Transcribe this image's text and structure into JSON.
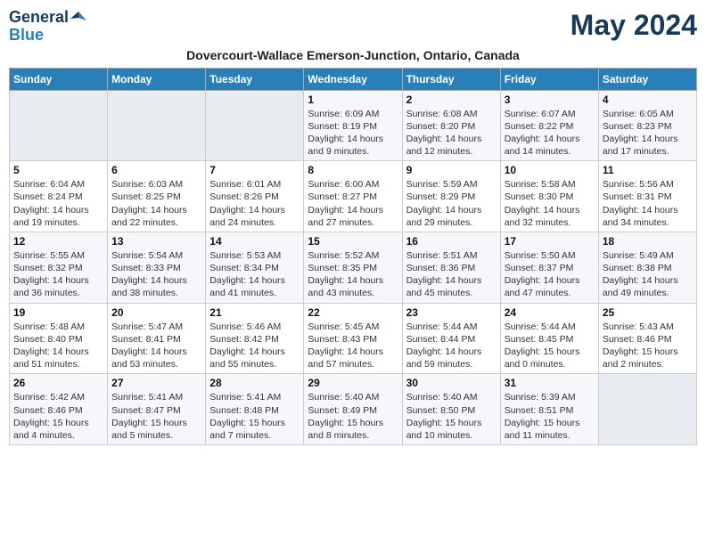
{
  "header": {
    "logo_general": "General",
    "logo_blue": "Blue",
    "month_title": "May 2024",
    "location": "Dovercourt-Wallace Emerson-Junction, Ontario, Canada"
  },
  "days_of_week": [
    "Sunday",
    "Monday",
    "Tuesday",
    "Wednesday",
    "Thursday",
    "Friday",
    "Saturday"
  ],
  "weeks": [
    [
      {
        "day": "",
        "info": ""
      },
      {
        "day": "",
        "info": ""
      },
      {
        "day": "",
        "info": ""
      },
      {
        "day": "1",
        "info": "Sunrise: 6:09 AM\nSunset: 8:19 PM\nDaylight: 14 hours\nand 9 minutes."
      },
      {
        "day": "2",
        "info": "Sunrise: 6:08 AM\nSunset: 8:20 PM\nDaylight: 14 hours\nand 12 minutes."
      },
      {
        "day": "3",
        "info": "Sunrise: 6:07 AM\nSunset: 8:22 PM\nDaylight: 14 hours\nand 14 minutes."
      },
      {
        "day": "4",
        "info": "Sunrise: 6:05 AM\nSunset: 8:23 PM\nDaylight: 14 hours\nand 17 minutes."
      }
    ],
    [
      {
        "day": "5",
        "info": "Sunrise: 6:04 AM\nSunset: 8:24 PM\nDaylight: 14 hours\nand 19 minutes."
      },
      {
        "day": "6",
        "info": "Sunrise: 6:03 AM\nSunset: 8:25 PM\nDaylight: 14 hours\nand 22 minutes."
      },
      {
        "day": "7",
        "info": "Sunrise: 6:01 AM\nSunset: 8:26 PM\nDaylight: 14 hours\nand 24 minutes."
      },
      {
        "day": "8",
        "info": "Sunrise: 6:00 AM\nSunset: 8:27 PM\nDaylight: 14 hours\nand 27 minutes."
      },
      {
        "day": "9",
        "info": "Sunrise: 5:59 AM\nSunset: 8:29 PM\nDaylight: 14 hours\nand 29 minutes."
      },
      {
        "day": "10",
        "info": "Sunrise: 5:58 AM\nSunset: 8:30 PM\nDaylight: 14 hours\nand 32 minutes."
      },
      {
        "day": "11",
        "info": "Sunrise: 5:56 AM\nSunset: 8:31 PM\nDaylight: 14 hours\nand 34 minutes."
      }
    ],
    [
      {
        "day": "12",
        "info": "Sunrise: 5:55 AM\nSunset: 8:32 PM\nDaylight: 14 hours\nand 36 minutes."
      },
      {
        "day": "13",
        "info": "Sunrise: 5:54 AM\nSunset: 8:33 PM\nDaylight: 14 hours\nand 38 minutes."
      },
      {
        "day": "14",
        "info": "Sunrise: 5:53 AM\nSunset: 8:34 PM\nDaylight: 14 hours\nand 41 minutes."
      },
      {
        "day": "15",
        "info": "Sunrise: 5:52 AM\nSunset: 8:35 PM\nDaylight: 14 hours\nand 43 minutes."
      },
      {
        "day": "16",
        "info": "Sunrise: 5:51 AM\nSunset: 8:36 PM\nDaylight: 14 hours\nand 45 minutes."
      },
      {
        "day": "17",
        "info": "Sunrise: 5:50 AM\nSunset: 8:37 PM\nDaylight: 14 hours\nand 47 minutes."
      },
      {
        "day": "18",
        "info": "Sunrise: 5:49 AM\nSunset: 8:38 PM\nDaylight: 14 hours\nand 49 minutes."
      }
    ],
    [
      {
        "day": "19",
        "info": "Sunrise: 5:48 AM\nSunset: 8:40 PM\nDaylight: 14 hours\nand 51 minutes."
      },
      {
        "day": "20",
        "info": "Sunrise: 5:47 AM\nSunset: 8:41 PM\nDaylight: 14 hours\nand 53 minutes."
      },
      {
        "day": "21",
        "info": "Sunrise: 5:46 AM\nSunset: 8:42 PM\nDaylight: 14 hours\nand 55 minutes."
      },
      {
        "day": "22",
        "info": "Sunrise: 5:45 AM\nSunset: 8:43 PM\nDaylight: 14 hours\nand 57 minutes."
      },
      {
        "day": "23",
        "info": "Sunrise: 5:44 AM\nSunset: 8:44 PM\nDaylight: 14 hours\nand 59 minutes."
      },
      {
        "day": "24",
        "info": "Sunrise: 5:44 AM\nSunset: 8:45 PM\nDaylight: 15 hours\nand 0 minutes."
      },
      {
        "day": "25",
        "info": "Sunrise: 5:43 AM\nSunset: 8:46 PM\nDaylight: 15 hours\nand 2 minutes."
      }
    ],
    [
      {
        "day": "26",
        "info": "Sunrise: 5:42 AM\nSunset: 8:46 PM\nDaylight: 15 hours\nand 4 minutes."
      },
      {
        "day": "27",
        "info": "Sunrise: 5:41 AM\nSunset: 8:47 PM\nDaylight: 15 hours\nand 5 minutes."
      },
      {
        "day": "28",
        "info": "Sunrise: 5:41 AM\nSunset: 8:48 PM\nDaylight: 15 hours\nand 7 minutes."
      },
      {
        "day": "29",
        "info": "Sunrise: 5:40 AM\nSunset: 8:49 PM\nDaylight: 15 hours\nand 8 minutes."
      },
      {
        "day": "30",
        "info": "Sunrise: 5:40 AM\nSunset: 8:50 PM\nDaylight: 15 hours\nand 10 minutes."
      },
      {
        "day": "31",
        "info": "Sunrise: 5:39 AM\nSunset: 8:51 PM\nDaylight: 15 hours\nand 11 minutes."
      },
      {
        "day": "",
        "info": ""
      }
    ]
  ]
}
